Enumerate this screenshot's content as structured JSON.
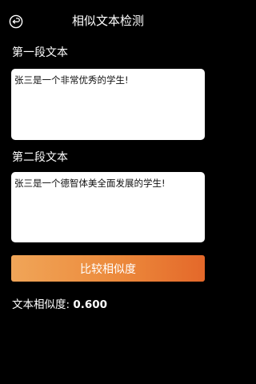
{
  "header": {
    "title": "相似文本检测",
    "back_icon": "back-arrow-circle-icon"
  },
  "sections": [
    {
      "label": "第一段文本",
      "text": "张三是一个非常优秀的学生!"
    },
    {
      "label": "第二段文本",
      "text": "张三是一个德智体美全面发展的学生!"
    }
  ],
  "button": {
    "label": "比较相似度"
  },
  "result": {
    "label": "文本相似度: ",
    "value": "0.600"
  },
  "colors": {
    "background": "#000000",
    "button_start": "#f0a558",
    "button_end": "#e4682a",
    "text_box": "#ffffff"
  }
}
